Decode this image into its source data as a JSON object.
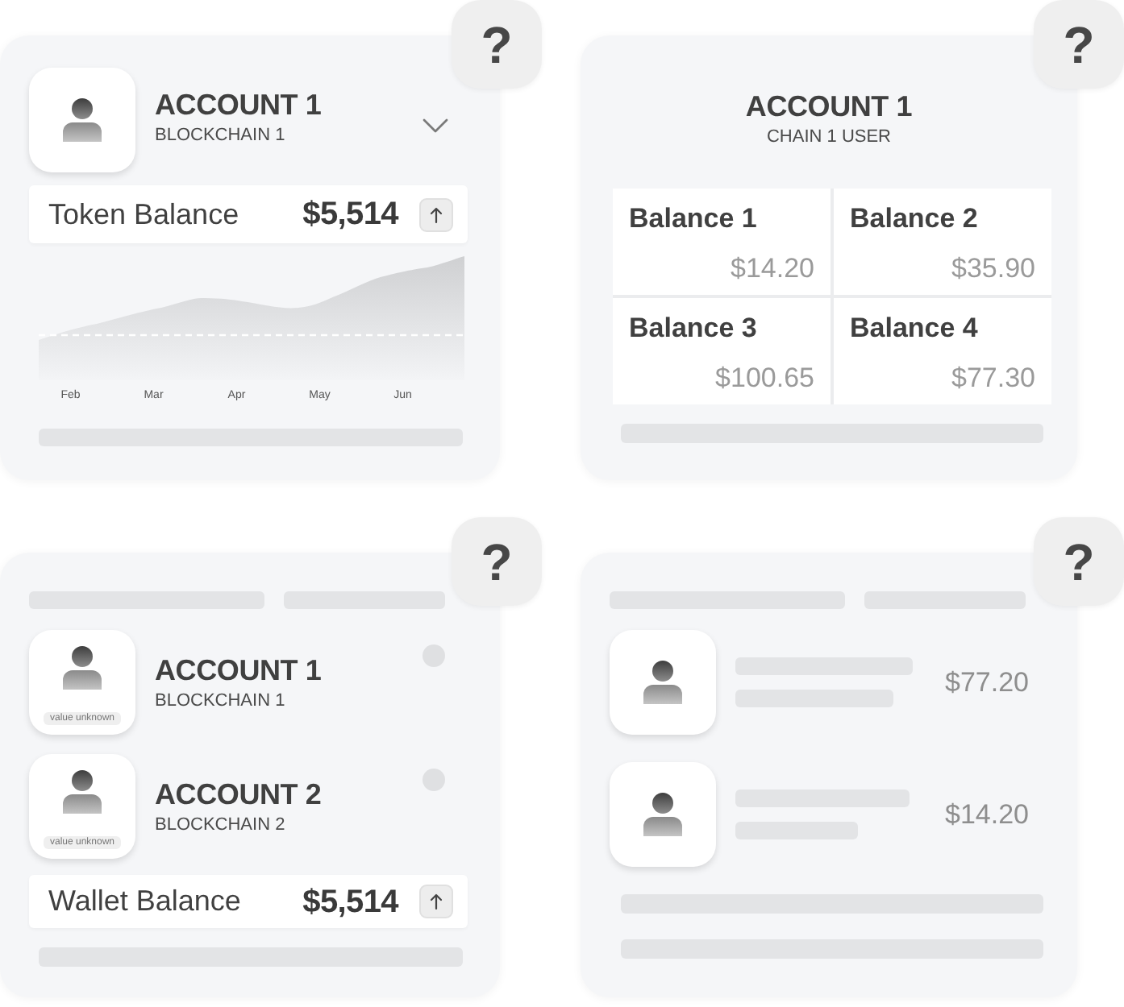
{
  "cards": [
    {
      "kind": "account_chart",
      "help": "?",
      "account": {
        "title": "ACCOUNT 1",
        "subtitle": "BLOCKCHAIN 1"
      },
      "expanded": false,
      "balance": {
        "label": "Token Balance",
        "amount": "$5,514"
      },
      "chart": {
        "x_labels": [
          "Feb",
          "Mar",
          "Apr",
          "May",
          "Jun"
        ]
      }
    },
    {
      "kind": "balance_grid",
      "help": "?",
      "title": "ACCOUNT 1",
      "subtitle": "CHAIN 1 USER",
      "balances": [
        {
          "label": "Balance 1",
          "amount": "$14.20"
        },
        {
          "label": "Balance 2",
          "amount": "$35.90"
        },
        {
          "label": "Balance 3",
          "amount": "$100.65"
        },
        {
          "label": "Balance 4",
          "amount": "$77.30"
        }
      ]
    },
    {
      "kind": "account_list",
      "help": "?",
      "accounts": [
        {
          "title": "ACCOUNT 1",
          "subtitle": "BLOCKCHAIN 1",
          "avatar_caption": "value unknown",
          "selected": false
        },
        {
          "title": "ACCOUNT 2",
          "subtitle": "BLOCKCHAIN 2",
          "avatar_caption": "value unknown",
          "selected": false
        }
      ],
      "balance": {
        "label": "Wallet Balance",
        "amount": "$5,514"
      }
    },
    {
      "kind": "amount_list",
      "help": "?",
      "items": [
        {
          "amount": "$77.20"
        },
        {
          "amount": "$14.20"
        }
      ]
    }
  ]
}
